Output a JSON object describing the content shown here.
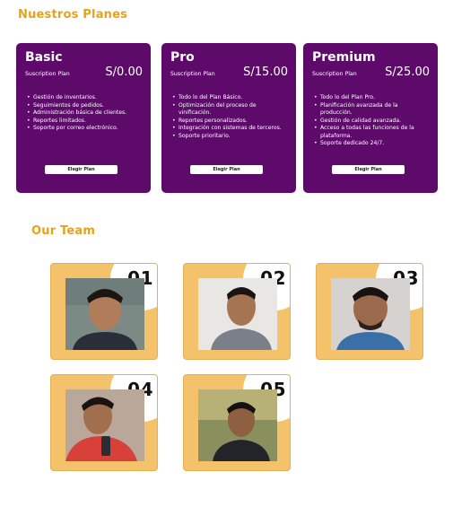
{
  "plans_section": {
    "title": "Nuestros Planes"
  },
  "plans": [
    {
      "name": "Basic",
      "subtitle": "Suscription Plan",
      "price": "S/0.00",
      "features": [
        "Gestión de inventarios.",
        "Seguimientos de pedidos.",
        "Administración básica de clientes.",
        "Reportes limitados.",
        "Soporte por correo electrónico."
      ],
      "button": "Elegir Plan"
    },
    {
      "name": "Pro",
      "subtitle": "Suscription Plan",
      "price": "S/15.00",
      "features": [
        "Todo lo del Plan Básico.",
        "Optimización del proceso de vinificación.",
        "Reportes personalizados.",
        "Integración con sistemas de terceros.",
        "Soporte prioritario."
      ],
      "button": "Elegir Plan"
    },
    {
      "name": "Premium",
      "subtitle": "Suscription Plan",
      "price": "S/25.00",
      "features": [
        "Todo lo del Plan Pro.",
        "Planificación avanzada de la producción.",
        "Gestión de calidad avanzada.",
        "Acceso a todas las funciones de la plataforma.",
        "Soporte dedicado 24/7."
      ],
      "button": "Elegir Plan"
    }
  ],
  "team_section": {
    "title": "Our Team"
  },
  "team": [
    {
      "number": "01"
    },
    {
      "number": "02"
    },
    {
      "number": "03"
    },
    {
      "number": "04"
    },
    {
      "number": "05"
    }
  ],
  "colors": {
    "accent": "#e8a21a",
    "plan_bg": "#5d0a6b",
    "card_bg": "#f4c26a"
  }
}
